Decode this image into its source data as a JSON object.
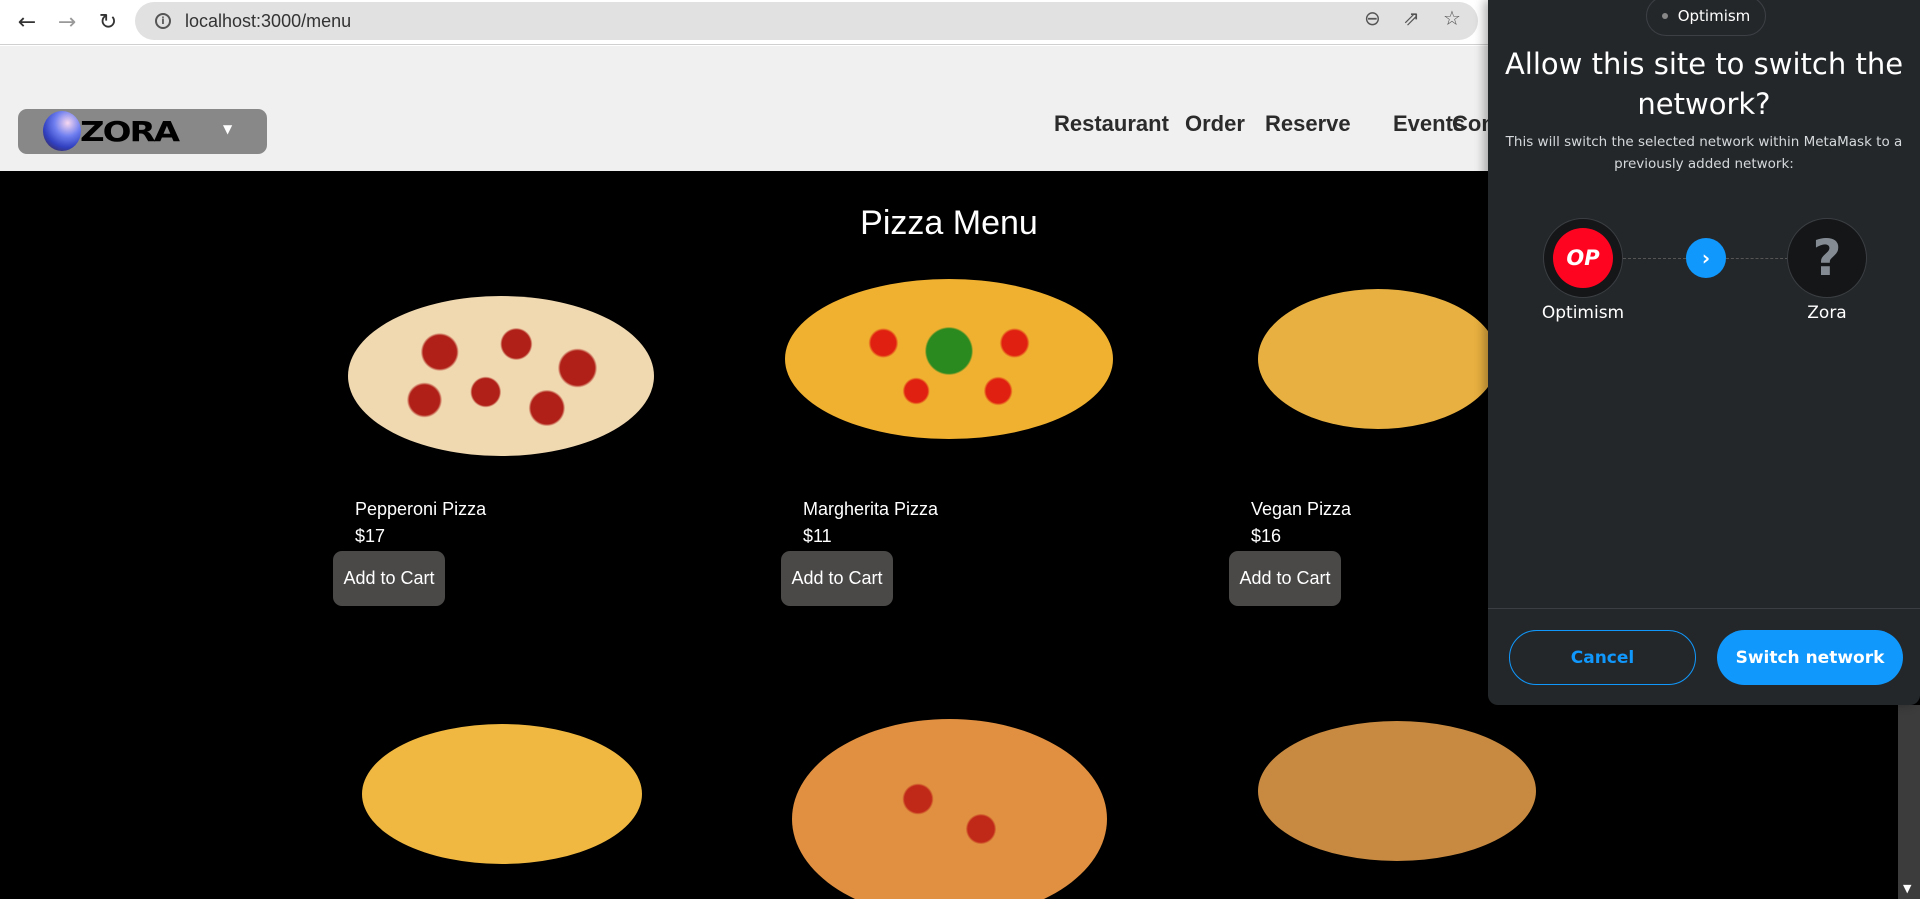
{
  "browser": {
    "url": "localhost:3000/menu",
    "icons": [
      "back-icon",
      "forward-icon",
      "reload-icon",
      "info-icon",
      "zoom-out-icon",
      "share-icon",
      "star-icon"
    ]
  },
  "header": {
    "logo_text": "ZORA",
    "nav": [
      "Restaurant",
      "Order",
      "Reserve",
      "Events",
      "Con"
    ]
  },
  "main": {
    "title": "Pizza Menu",
    "items": [
      {
        "name": "Pepperoni Pizza",
        "price": "$17",
        "button": "Add to Cart"
      },
      {
        "name": "Margherita Pizza",
        "price": "$11",
        "button": "Add to Cart"
      },
      {
        "name": "Vegan Pizza",
        "price": "$16",
        "button": "Add to Cart"
      }
    ]
  },
  "popup": {
    "current_network": "Optimism",
    "title": "Allow this site to switch the network?",
    "subtitle": "This will switch the selected network within MetaMask to a previously added network:",
    "from": {
      "label": "Optimism",
      "badge": "OP",
      "color": "#ff0420"
    },
    "to": {
      "label": "Zora",
      "badge": "?"
    },
    "cancel": "Cancel",
    "confirm": "Switch network",
    "accent": "#1098fc"
  }
}
